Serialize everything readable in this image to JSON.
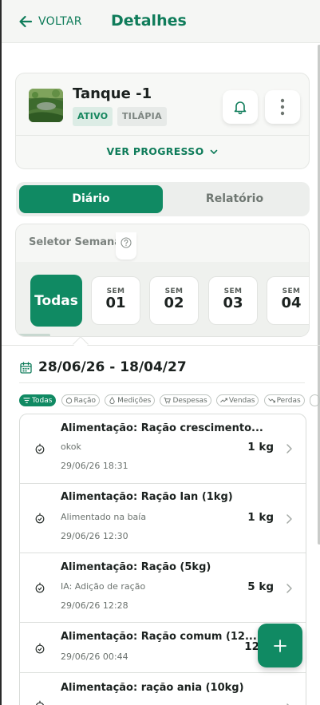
{
  "header": {
    "back_label": "VOLTAR",
    "title": "Detalhes"
  },
  "tank": {
    "name": "Tanque -1",
    "status": "ATIVO",
    "species": "TILÁPIA",
    "progress_label": "VER PROGRESSO"
  },
  "tabs": [
    {
      "label": "Diário",
      "active": true
    },
    {
      "label": "Relatório",
      "active": false
    }
  ],
  "week_selector": {
    "label": "Seletor Semanal",
    "all_label": "Todas",
    "weeks": [
      {
        "prefix": "SEM",
        "number": "01"
      },
      {
        "prefix": "SEM",
        "number": "02"
      },
      {
        "prefix": "SEM",
        "number": "03"
      },
      {
        "prefix": "SEM",
        "number": "04"
      }
    ]
  },
  "date_range": "28/06/26 - 18/04/27",
  "filters": [
    {
      "label": "Todas",
      "icon": "filter-icon",
      "active": true
    },
    {
      "label": "Ração",
      "icon": "feed-icon",
      "active": false
    },
    {
      "label": "Medições",
      "icon": "drop-icon",
      "active": false
    },
    {
      "label": "Despesas",
      "icon": "cart-icon",
      "active": false
    },
    {
      "label": "Vendas",
      "icon": "trend-up-icon",
      "active": false
    },
    {
      "label": "Perdas",
      "icon": "trend-down-icon",
      "active": false
    }
  ],
  "entries": [
    {
      "title": "Alimentação: Ração crescimentо...",
      "note": "okok",
      "date": "29/06/26 18:31",
      "amount": "1 kg"
    },
    {
      "title": "Alimentação: Ração Ian (1kg)",
      "note": "Alimentado na baía",
      "date": "29/06/26 12:30",
      "amount": "1 kg"
    },
    {
      "title": "Alimentação: Ração (5kg)",
      "note": "IA: Adição de ração",
      "date": "29/06/26 12:28",
      "amount": "5 kg"
    },
    {
      "title": "Alimentação: Ração comum (12...",
      "note": "",
      "date": "29/06/26 00:44",
      "amount": "12"
    },
    {
      "title": "Alimentação: ração ania (10kg)",
      "note": "",
      "date": "",
      "amount": ""
    }
  ],
  "colors": {
    "primary": "#108a63",
    "accent_text": "#0f7c5a"
  }
}
